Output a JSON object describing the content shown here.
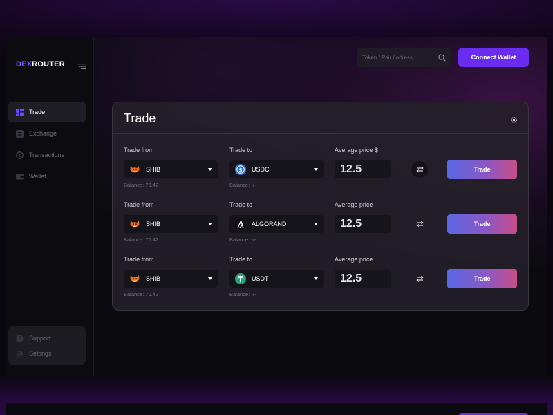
{
  "brand": {
    "part1": "DEX",
    "part2": "ROUTER",
    "accent": "#7a5cff"
  },
  "sidebar": {
    "items": [
      {
        "label": "Trade",
        "icon": "grid-icon",
        "active": true
      },
      {
        "label": "Exchange",
        "icon": "exchange-icon",
        "active": false
      },
      {
        "label": "Transactions",
        "icon": "dollar-circle-icon",
        "active": false
      },
      {
        "label": "Wallet",
        "icon": "wallet-icon",
        "active": false
      }
    ],
    "bottom": [
      {
        "label": "Support",
        "icon": "help-icon"
      },
      {
        "label": "Settings",
        "icon": "gear-icon"
      }
    ]
  },
  "header": {
    "search_placeholder": "Token / Pair / adress...",
    "connect_label": "Connect Wallet",
    "connect_color": "#6a2df0"
  },
  "card": {
    "title": "Trade",
    "rows": [
      {
        "from_label": "Trade from",
        "from_token": "SHIB",
        "from_icon": "shib-icon",
        "from_balance": "Balance: 70.42",
        "to_label": "Trade to",
        "to_token": "USDC",
        "to_icon": "usdc-icon",
        "to_balance": "Balance: -/-",
        "price_label": "Average price $",
        "price_value": "12.5",
        "trade_label": "Trade"
      },
      {
        "from_label": "Trade from",
        "from_token": "SHIB",
        "from_icon": "shib-icon",
        "from_balance": "Balance: 70.42",
        "to_label": "Trade to",
        "to_token": "ALGORAND",
        "to_icon": "algorand-icon",
        "to_balance": "Balance: -/-",
        "price_label": "Average price",
        "price_value": "12.5",
        "trade_label": "Trade"
      },
      {
        "from_label": "Trade from",
        "from_token": "SHIB",
        "from_icon": "shib-icon",
        "from_balance": "Balance: 70.42",
        "to_label": "Trade to",
        "to_token": "USDT",
        "to_icon": "usdt-icon",
        "to_balance": "Balance: -/-",
        "price_label": "Average price",
        "price_value": "12.5",
        "trade_label": "Trade"
      }
    ]
  }
}
